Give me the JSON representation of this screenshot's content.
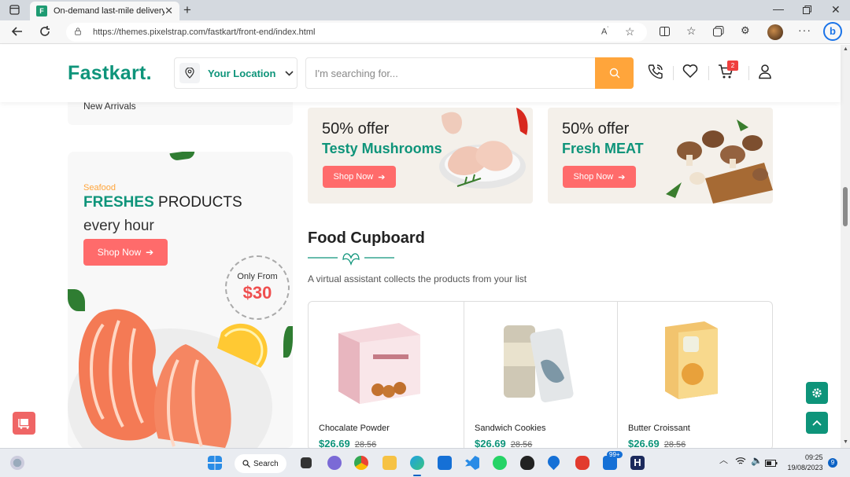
{
  "browser": {
    "tab_title": "On-demand last-mile delivery",
    "favicon_letter": "F",
    "url": "https://themes.pixelstrap.com/fastkart/front-end/index.html"
  },
  "header": {
    "logo_text": "Fastkart",
    "logo_dot": ".",
    "location_label": "Your Location",
    "search_placeholder": "I'm searching for...",
    "cart_count": "2"
  },
  "sidebar": {
    "menu_item": "New Arrivals",
    "promo": {
      "eyebrow": "Seafood",
      "headline_bold": "FRESHES",
      "headline_rest": " PRODUCTS",
      "headline_line2": "every hour",
      "button_label": "Shop Now",
      "price_label": "Only From",
      "price_value": "$30"
    }
  },
  "offers": [
    {
      "percent": "50% offer",
      "name": "Testy Mushrooms",
      "button_label": "Shop Now"
    },
    {
      "percent": "50% offer",
      "name": "Fresh MEAT",
      "button_label": "Shop Now"
    }
  ],
  "section": {
    "title": "Food Cupboard",
    "subtitle": "A virtual assistant collects the products from your list"
  },
  "products": [
    {
      "name": "Chocalate Powder",
      "price": "$26.69",
      "old_price": "28.56"
    },
    {
      "name": "Sandwich Cookies",
      "price": "$26.69",
      "old_price": "28.56"
    },
    {
      "name": "Butter Croissant",
      "price": "$26.69",
      "old_price": "28.56"
    }
  ],
  "taskbar": {
    "search_label": "Search",
    "time": "09:25",
    "date": "19/08/2023",
    "notification_count": "9",
    "badge_count": "99+"
  },
  "colors": {
    "brand_green": "#0e947a",
    "accent_orange": "#ffa53b",
    "button_red": "#ff6b6b",
    "price_red": "#ef4f4f"
  }
}
